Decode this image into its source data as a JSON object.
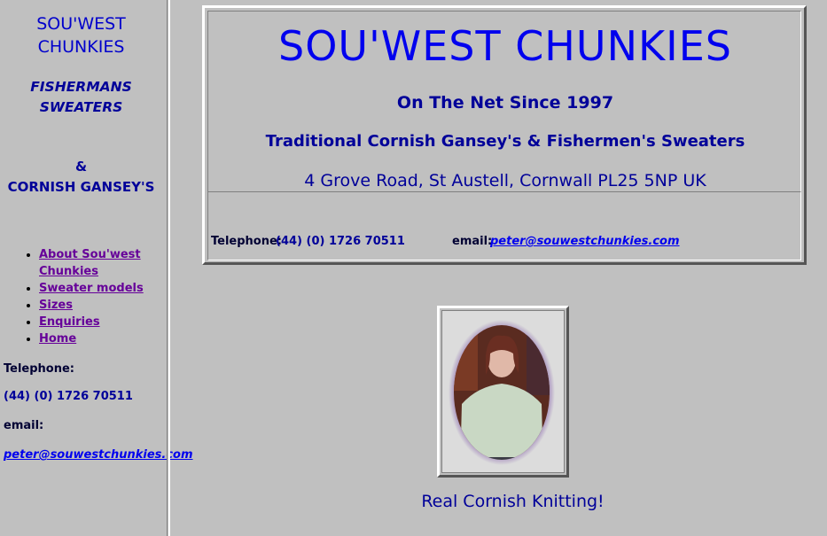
{
  "sidebar": {
    "title_line1": "SOU'WEST",
    "title_line2": "CHUNKIES",
    "sub_line1": "FISHERMANS",
    "sub_line2": "SWEATERS",
    "ampersand": "&",
    "gansey": "CORNISH GANSEY'S",
    "nav": [
      {
        "label": "About Sou'west Chunkies"
      },
      {
        "label": "Sweater models"
      },
      {
        "label": "Sizes"
      },
      {
        "label": "Enquiries"
      },
      {
        "label": "Home"
      }
    ],
    "telephone_label": "Telephone:",
    "telephone_value": "(44) (0) 1726 70511",
    "email_label": "email:",
    "email_value": "peter@souwestchunkies.com"
  },
  "header": {
    "title": "SOU'WEST CHUNKIES",
    "since": "On The Net Since 1997",
    "tagline": "Traditional Cornish Gansey's & Fishermen's Sweaters",
    "address": "4 Grove Road, St Austell, Cornwall PL25 5NP UK",
    "telephone_label": "Telephone:",
    "telephone_value": "(44) (0) 1726 70511",
    "email_label": "email:",
    "email_value": "peter@souwestchunkies.com"
  },
  "photo": {
    "caption": "Real Cornish Knitting!"
  },
  "colors": {
    "background": "#c0c0c0",
    "title_blue": "#0000ee",
    "text_navy": "#000099",
    "visited_link": "#660099"
  }
}
